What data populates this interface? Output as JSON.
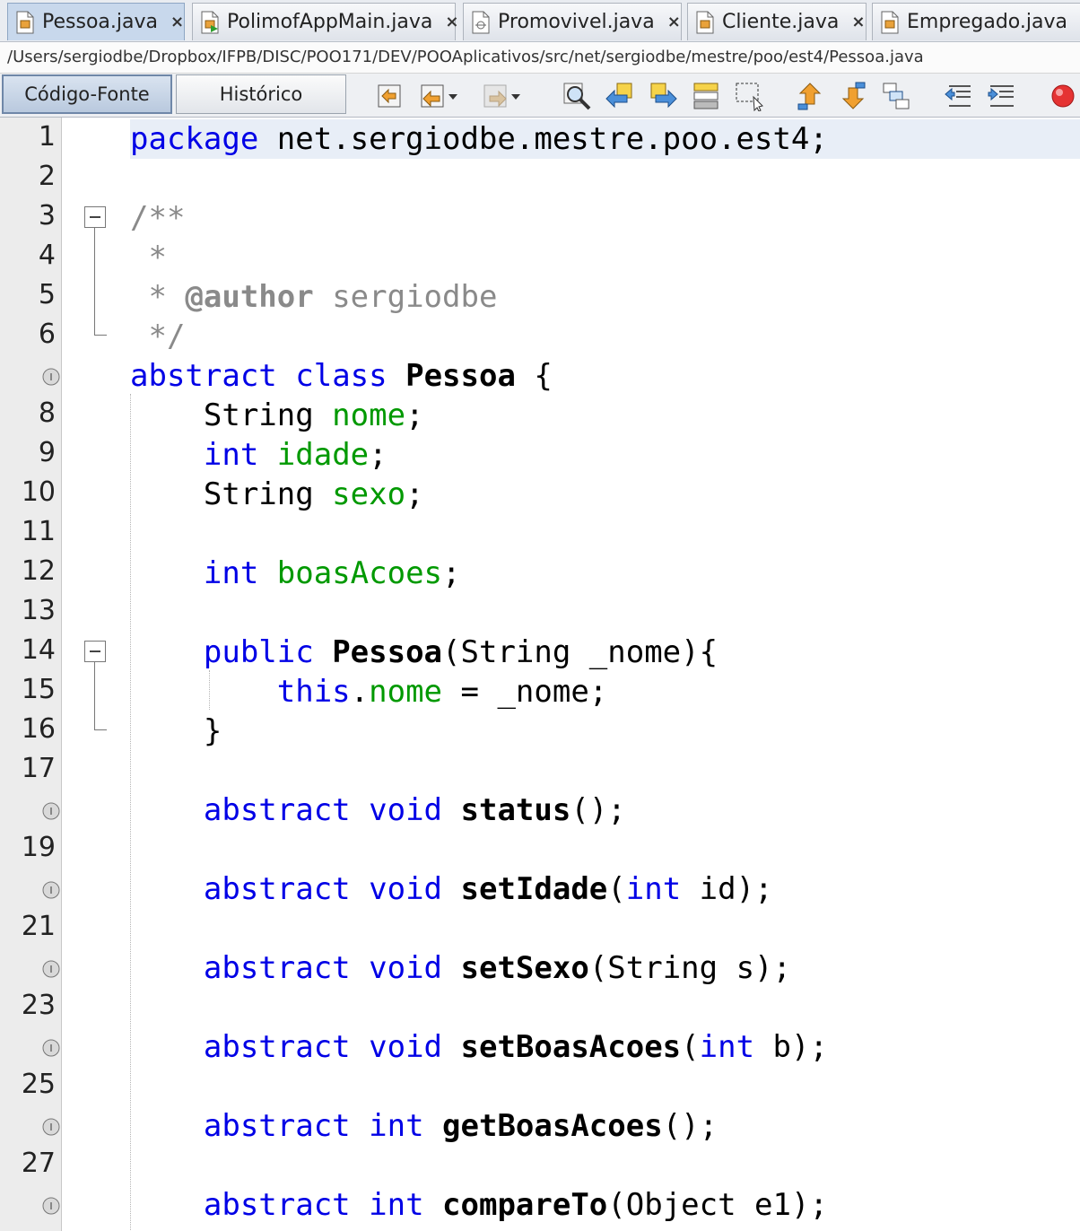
{
  "tabs": [
    {
      "label": "Pessoa.java",
      "close": "×",
      "active": true
    },
    {
      "label": "PolimofAppMain.java",
      "close": "×"
    },
    {
      "label": "Promovivel.java",
      "close": "×"
    },
    {
      "label": "Cliente.java",
      "close": "×"
    },
    {
      "label": "Empregado.java",
      "close": "×"
    }
  ],
  "path": "/Users/sergiodbe/Dropbox/IFPB/DISC/POO171/DEV/POOAplicativos/src/net/sergiodbe/mestre/poo/est4/Pessoa.java",
  "view_buttons": {
    "source": "Código-Fonte",
    "history": "Histórico"
  },
  "toolbar_icons": [
    "last-edit-icon",
    "back-icon",
    "forward-icon",
    "find-icon",
    "find-previous-icon",
    "find-next-icon",
    "toggle-highlight-icon",
    "toggle-rectangular-selection-icon",
    "previous-bookmark-icon",
    "next-bookmark-icon",
    "toggle-bookmark-icon",
    "shift-left-icon",
    "shift-right-icon",
    "record-macro-icon"
  ],
  "colors": {
    "keyword": "#0000e6",
    "field": "#009900",
    "comment": "#8a8a8a",
    "current_line": "#e8eef7",
    "record": "#e53333"
  },
  "lines": [
    {
      "n": "1",
      "text": "package net.sergiodbe.mestre.poo.est4;"
    },
    {
      "n": "2",
      "text": ""
    },
    {
      "n": "3",
      "text": "/**"
    },
    {
      "n": "4",
      "text": " *"
    },
    {
      "n": "5",
      "text": " * @author sergiodbe"
    },
    {
      "n": "6",
      "text": " */"
    },
    {
      "n": "",
      "text": "abstract class Pessoa {"
    },
    {
      "n": "8",
      "text": "    String nome;"
    },
    {
      "n": "9",
      "text": "    int idade;"
    },
    {
      "n": "10",
      "text": "    String sexo;"
    },
    {
      "n": "11",
      "text": ""
    },
    {
      "n": "12",
      "text": "    int boasAcoes;"
    },
    {
      "n": "13",
      "text": ""
    },
    {
      "n": "14",
      "text": "    public Pessoa(String _nome){"
    },
    {
      "n": "15",
      "text": "        this.nome = _nome;"
    },
    {
      "n": "16",
      "text": "    }"
    },
    {
      "n": "17",
      "text": ""
    },
    {
      "n": "",
      "text": "    abstract void status();"
    },
    {
      "n": "19",
      "text": ""
    },
    {
      "n": "",
      "text": "    abstract void setIdade(int id);"
    },
    {
      "n": "21",
      "text": ""
    },
    {
      "n": "",
      "text": "    abstract void setSexo(String s);"
    },
    {
      "n": "23",
      "text": ""
    },
    {
      "n": "",
      "text": "    abstract void setBoasAcoes(int b);"
    },
    {
      "n": "25",
      "text": ""
    },
    {
      "n": "",
      "text": "    abstract int getBoasAcoes();"
    },
    {
      "n": "27",
      "text": ""
    },
    {
      "n": "",
      "text": "    abstract int compareTo(Object e1);"
    }
  ]
}
